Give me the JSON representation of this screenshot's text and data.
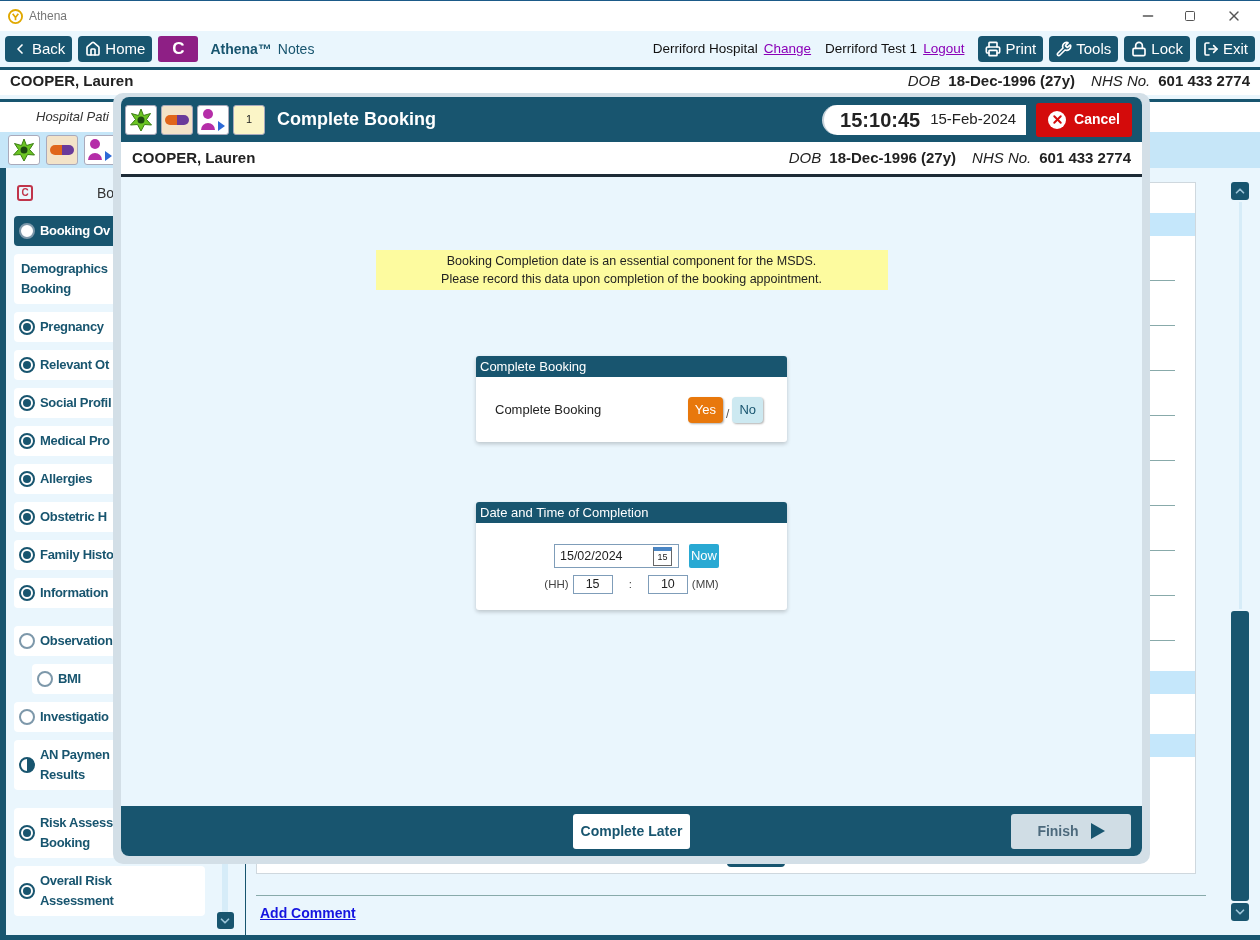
{
  "window": {
    "title": "Athena"
  },
  "toolbar": {
    "nav": [
      {
        "label": "Back"
      },
      {
        "label": "Home"
      }
    ],
    "case_badge": "C",
    "app_name": "Athena™",
    "app_section": "Notes",
    "hospital": "Derriford Hospital",
    "change_link": "Change",
    "user": "Derriford Test 1",
    "logout_link": "Logout",
    "actions": [
      {
        "label": "Print"
      },
      {
        "label": "Tools"
      },
      {
        "label": "Lock"
      },
      {
        "label": "Exit"
      }
    ]
  },
  "patient": {
    "name": "COOPER, Lauren",
    "dob_label": "DOB",
    "dob": "18-Dec-1996 (27y)",
    "nhs_label": "NHS No.",
    "nhs": "601 433 2774"
  },
  "subheader": "Hospital Pati",
  "sidebar": {
    "case_icon": "C",
    "heading": "Bo",
    "groups": [
      [
        {
          "label": "Booking Ov",
          "kind": "empty",
          "selected": true
        },
        {
          "label": "Demographics\nBooking",
          "kind": "none",
          "selected": false
        },
        {
          "label": "Pregnancy",
          "kind": "complete",
          "selected": false
        },
        {
          "label": "Relevant Ot",
          "kind": "complete",
          "selected": false
        },
        {
          "label": "Social Profil",
          "kind": "complete",
          "selected": false
        },
        {
          "label": "Medical Pro",
          "kind": "complete",
          "selected": false
        },
        {
          "label": "Allergies",
          "kind": "complete",
          "selected": false
        },
        {
          "label": "Obstetric H",
          "kind": "complete",
          "selected": false
        },
        {
          "label": "Family Histo",
          "kind": "complete",
          "selected": false
        },
        {
          "label": "Information",
          "kind": "complete",
          "selected": false
        }
      ],
      [
        {
          "label": "Observation",
          "kind": "empty",
          "selected": false,
          "children": [
            {
              "label": "BMI",
              "kind": "empty",
              "selected": false
            }
          ]
        },
        {
          "label": "Investigatio",
          "kind": "empty",
          "selected": false
        },
        {
          "label": "AN Paymen\nResults",
          "kind": "partial",
          "selected": false
        }
      ],
      [
        {
          "label": "Risk Assess\nBooking",
          "kind": "complete",
          "selected": false
        },
        {
          "label": "Overall Risk\nAssessment",
          "kind": "complete",
          "selected": false
        }
      ]
    ]
  },
  "footer": {
    "link": "Add Comment"
  },
  "modal": {
    "title": "Complete Booking",
    "calendar_day": "1",
    "time": "15:10:45",
    "date": "15-Feb-2024",
    "cancel": "Cancel",
    "patient": {
      "name": "COOPER, Lauren",
      "dob_label": "DOB",
      "dob": "18-Dec-1996 (27y)",
      "nhs_label": "NHS No.",
      "nhs": "601 433 2774"
    },
    "notice": [
      "Booking Completion date is an essential component for the MSDS.",
      "Please record this data upon completion of the booking appointment."
    ],
    "complete_booking": {
      "title": "Complete Booking",
      "label": "Complete Booking",
      "separator": "/",
      "options": [
        {
          "label": "Yes",
          "selected": true
        },
        {
          "label": "No",
          "selected": false
        }
      ]
    },
    "completion": {
      "title": "Date and Time of Completion",
      "date": "15/02/2024",
      "calendar_day": "15",
      "now": "Now",
      "hour_label": "(HH)",
      "hour": "15",
      "separator": ":",
      "minute": "10",
      "minute_label": "(MM)"
    },
    "complete_later": "Complete Later",
    "finish": {
      "label": "Finish",
      "disabled": true
    }
  }
}
